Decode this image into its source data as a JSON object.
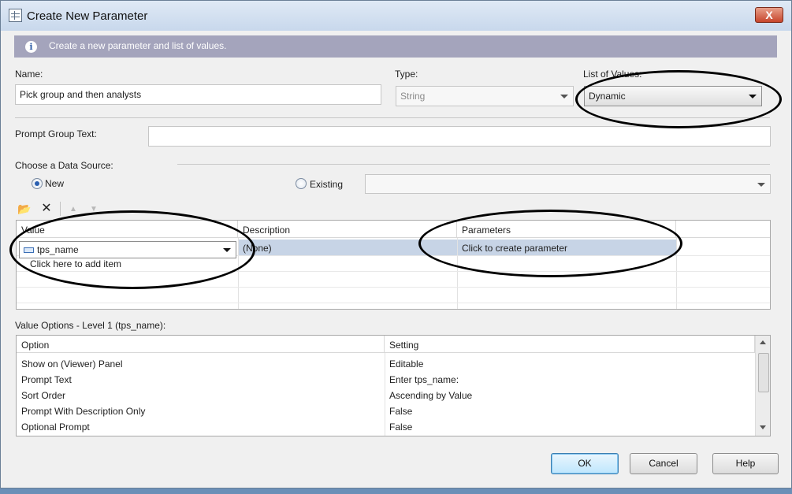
{
  "window": {
    "title": "Create New Parameter",
    "close_glyph": "X"
  },
  "info": {
    "icon": "info-icon",
    "glyph": "i",
    "text": "Create a new parameter and list of values."
  },
  "form": {
    "name_label": "Name:",
    "name_value": "Pick group and then analysts",
    "type_label": "Type:",
    "type_value": "String",
    "lov_label": "List of Values:",
    "lov_value": "Dynamic",
    "prompt_group_label": "Prompt Group Text:",
    "prompt_group_value": "",
    "datasource_label": "Choose a Data Source:",
    "radio_new": "New",
    "radio_existing": "Existing",
    "existing_value": ""
  },
  "values_grid": {
    "columns": [
      "Value",
      "Description",
      "Parameters"
    ],
    "row": {
      "value": "tps_name",
      "description": "(None)",
      "parameters": "Click to create parameter"
    },
    "add_item": "Click here to add item"
  },
  "value_options": {
    "label": "Value Options - Level 1 (tps_name):",
    "columns": [
      "Option",
      "Setting"
    ],
    "rows": [
      {
        "option": "Show on (Viewer) Panel",
        "setting": "Editable"
      },
      {
        "option": "Prompt Text",
        "setting": "Enter tps_name:"
      },
      {
        "option": "Sort Order",
        "setting": "Ascending by Value"
      },
      {
        "option": "Prompt With Description Only",
        "setting": "False"
      },
      {
        "option": "Optional Prompt",
        "setting": "False"
      }
    ]
  },
  "buttons": {
    "ok": "OK",
    "cancel": "Cancel",
    "help": "Help"
  },
  "colors": {
    "info_bar": "#a4a4bc",
    "selection": "#c7d4e6",
    "annotation": "#000000"
  }
}
